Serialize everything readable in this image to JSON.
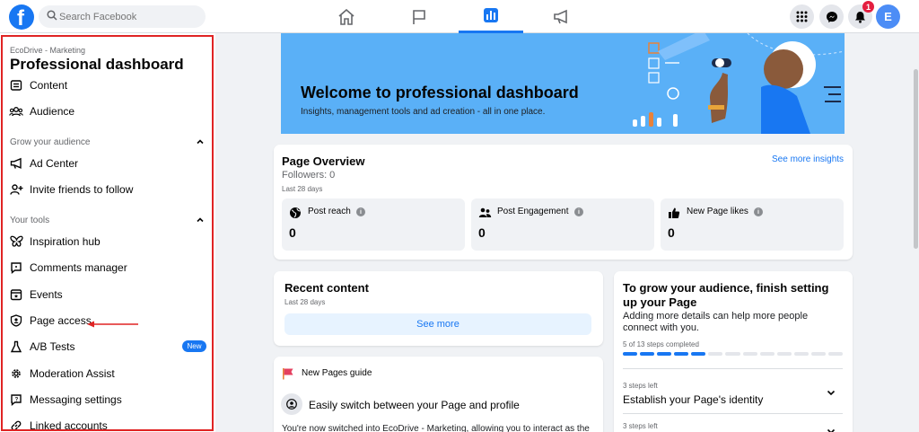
{
  "topbar": {
    "logo_letter": "f",
    "search_placeholder": "Search Facebook",
    "notification_count": "1",
    "avatar_initial": "E"
  },
  "sidebar": {
    "page_name": "EcoDrive - Marketing",
    "title": "Professional dashboard",
    "items_top": [
      {
        "label": "Content",
        "icon": "content-icon"
      },
      {
        "label": "Audience",
        "icon": "audience-icon"
      }
    ],
    "section_grow": "Grow your audience",
    "items_grow": [
      {
        "label": "Ad Center",
        "icon": "megaphone-icon"
      },
      {
        "label": "Invite friends to follow",
        "icon": "invite-icon"
      }
    ],
    "section_tools": "Your tools",
    "items_tools": [
      {
        "label": "Inspiration hub",
        "icon": "butterfly-icon"
      },
      {
        "label": "Comments manager",
        "icon": "comments-icon"
      },
      {
        "label": "Events",
        "icon": "calendar-icon"
      },
      {
        "label": "Page access",
        "icon": "shield-user-icon"
      },
      {
        "label": "A/B Tests",
        "icon": "flask-icon"
      },
      {
        "label": "Moderation Assist",
        "icon": "gear-icon"
      },
      {
        "label": "Messaging settings",
        "icon": "message-icon"
      },
      {
        "label": "Linked accounts",
        "icon": "link-icon"
      }
    ],
    "new_badge": "New"
  },
  "banner": {
    "title": "Welcome to professional dashboard",
    "subtitle": "Insights, management tools and ad creation - all in one place."
  },
  "overview": {
    "title": "Page Overview",
    "followers": "Followers: 0",
    "period": "Last 28 days",
    "see_more_insights": "See more insights",
    "stats": [
      {
        "label": "Post reach",
        "value": "0",
        "icon": "globe-icon"
      },
      {
        "label": "Post Engagement",
        "value": "0",
        "icon": "people-icon"
      },
      {
        "label": "New Page likes",
        "value": "0",
        "icon": "thumbs-up-icon"
      }
    ]
  },
  "recent": {
    "title": "Recent content",
    "period": "Last 28 days",
    "see_more": "See more"
  },
  "guide": {
    "title": "New Pages guide",
    "heading": "Easily switch between your Page and profile",
    "body": "You're now switched into EcoDrive - Marketing, allowing you to interact as the"
  },
  "grow": {
    "title": "To grow your audience, finish setting up your Page",
    "description": "Adding more details can help more people connect with you.",
    "steps_completed": "5 of 13 steps completed",
    "steps_done": 5,
    "steps_total": 13,
    "sections": [
      {
        "left": "3 steps left",
        "title": "Establish your Page's identity"
      },
      {
        "left": "3 steps left",
        "title": ""
      }
    ]
  },
  "colors": {
    "brand": "#1877f2",
    "banner": "#5ab0f7",
    "highlight_border": "#e02424"
  }
}
